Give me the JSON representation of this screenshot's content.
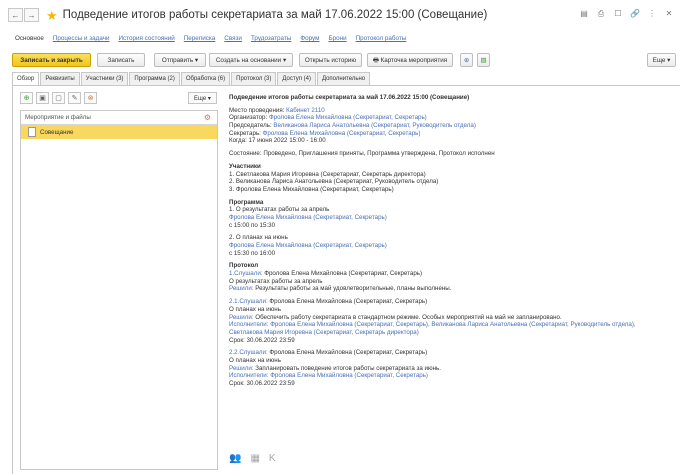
{
  "window": {
    "title": "Подведение итогов работы секретариата за май 17.06.2022 15:00 (Совещание)",
    "back": "←",
    "forward": "→",
    "star": "★",
    "icons": [
      "▤",
      "⎙",
      "☐",
      "🔗",
      "⋮",
      "✕"
    ]
  },
  "navlinks": [
    "Основное",
    "Процессы и задачи",
    "История состояний",
    "Переписка",
    "Связи",
    "Трудозатраты",
    "Форум",
    "Брони",
    "Протокол работы"
  ],
  "toolbar": {
    "save_close": "Записать и закрыть",
    "save": "Записать",
    "send": "Отправить ▾",
    "create_based": "Создать на основании ▾",
    "open_history": "Открыть историю",
    "event_card": "🖶 Карточка мероприятия",
    "more": "Еще ▾",
    "icon1": "⊕",
    "icon2": "▨"
  },
  "tabs": [
    "Обзор",
    "Реквизиты",
    "Участники (3)",
    "Программа (2)",
    "Обработка (6)",
    "Протокол (3)",
    "Доступ (4)",
    "Дополнительно"
  ],
  "left": {
    "tool_icons": [
      "⊕",
      "▣",
      "▢",
      "✎",
      "⊗"
    ],
    "more": "Еще ▾",
    "list_header": "Мероприятие и файлы",
    "item": "Совещание"
  },
  "content": {
    "heading": "Подведение итогов работы секретариата за май 17.06.2022 15:00 (Совещание)",
    "place_label": "Место проведения:",
    "place_value": "Кабинет 2110",
    "organizer_label": "Организатор:",
    "organizer_value": "Фролова Елена Михайловна (Секретариат, Секретарь)",
    "chair_label": "Председатель:",
    "chair_value": "Великанова Лариса Анатольевна (Секретариат, Руководитель отдела)",
    "secretary_label": "Секретарь:",
    "secretary_value": "Фролова Елена Михайловна (Секретариат, Секретарь)",
    "when_label": "Когда:",
    "when_value": "17 июня 2022 15:00 - 16:00",
    "status_label": "Состояние:",
    "status_value": "Проведено, Приглашения приняты, Программа утверждена, Протокол исполнен",
    "participants_title": "Участники",
    "participants": [
      "1. Светлакова Мария Игоревна (Секретариат, Секретарь директора)",
      "2. Великанова Лариса Анатольевна (Секретариат, Руководитель отдела)",
      "3. Фролова Елена Михайловна (Секретариат, Секретарь)"
    ],
    "program_title": "Программа",
    "program": [
      {
        "title": "1. О результатах работы за апрель",
        "person": "Фролова Елена Михайловна (Секретариат, Секретарь)",
        "time": "с 15:00 по 15:30"
      },
      {
        "title": "2. О планах на июнь",
        "person": "Фролова Елена Михайловна (Секретариат, Секретарь)",
        "time": "с 15:30 по 16:00"
      }
    ],
    "protocol_title": "Протокол",
    "p1": {
      "heard_label": "1.Слушали:",
      "heard": "Фролова Елена Михайловна (Секретариат, Секретарь)",
      "topic": "О результатах работы за апрель",
      "decided_label": "Решили:",
      "decided": "Результаты работы за май удовлетворительные, планы выполнены."
    },
    "p21": {
      "heard_label": "2.1.Слушали:",
      "heard": "Фролова Елена Михайловна (Секретариат, Секретарь)",
      "topic": "О планах на июнь",
      "decided_label": "Решили:",
      "decided": "Обеспечить работу секретариата в стандартном режиме. Особых мероприятий на май не запланировано.",
      "exec_label": "Исполнители:",
      "exec_1": "Фролова Елена Михайловна (Секретариат, Секретарь), Великанова Лариса Анатольевна (Секретариат, Руководитель отдела),",
      "exec_2": "Светлакова Мария Игоревна (Секретариат, Секретарь директора)",
      "term_label": "Срок:",
      "term": "30.06.2022 23:59"
    },
    "p22": {
      "heard_label": "2.2.Слушали:",
      "heard": "Фролова Елена Михайловна (Секретариат, Секретарь)",
      "topic": "О планах на июнь",
      "decided_label": "Решили:",
      "decided": "Запланировать поведение итогов работы секретариата за июнь.",
      "exec_label": "Исполнители:",
      "exec_1": "Фролова Елена Михайловна (Секретариат, Секретарь)",
      "term_label": "Срок:",
      "term": "30.06.2022 23:59"
    }
  },
  "bottom_icons": [
    "👥",
    "▦",
    "K"
  ]
}
